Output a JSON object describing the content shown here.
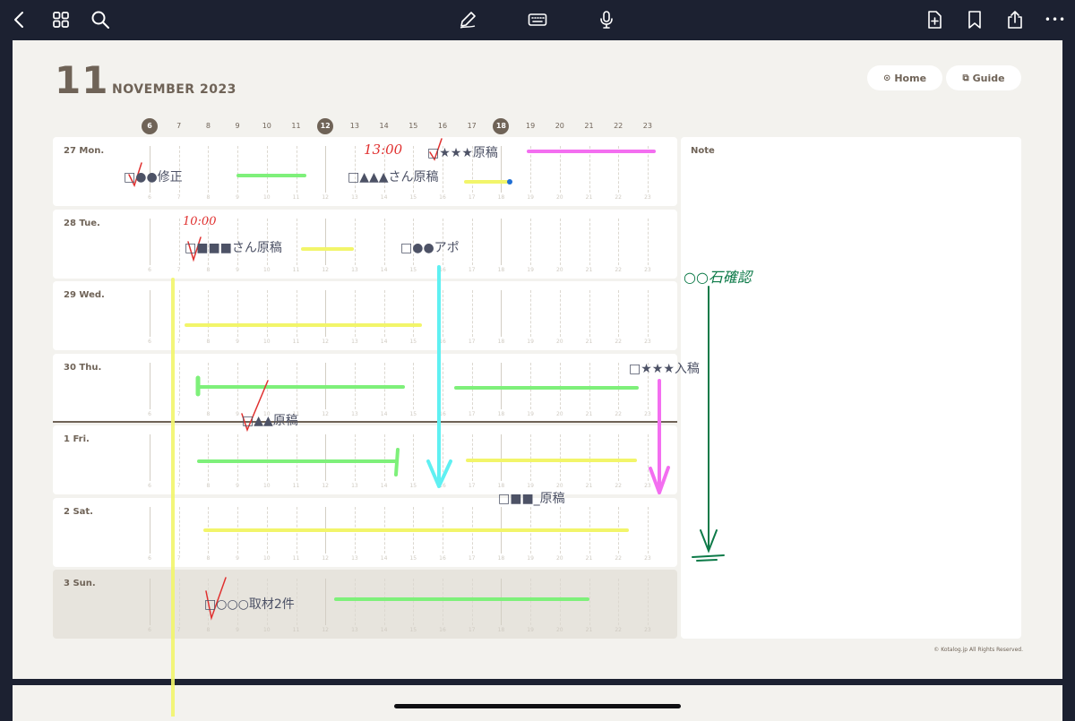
{
  "toolbar": {
    "icons": [
      "back-icon",
      "grid-icon",
      "search-icon",
      "pen-icon",
      "keyboard-icon",
      "microphone-icon",
      "add-page-icon",
      "bookmark-icon",
      "share-icon",
      "more-icon"
    ],
    "more_label": "•••"
  },
  "header": {
    "month_number": "11",
    "month_name": "NOVEMBER  2023",
    "home_label": "Home",
    "guide_label": "Guide"
  },
  "hours": [
    "6",
    "7",
    "8",
    "9",
    "10",
    "11",
    "12",
    "13",
    "14",
    "15",
    "16",
    "17",
    "18",
    "19",
    "20",
    "21",
    "22",
    "23"
  ],
  "marked_hours": [
    "6",
    "12",
    "18"
  ],
  "days": [
    {
      "label": "27  Mon.",
      "sunday": false
    },
    {
      "label": "28  Tue.",
      "sunday": false
    },
    {
      "label": "29  Wed.",
      "sunday": false
    },
    {
      "label": "30  Thu.",
      "sunday": false
    },
    {
      "label": "1    Fri.",
      "sunday": false
    },
    {
      "label": "2    Sat.",
      "sunday": false
    },
    {
      "label": "3    Sun.",
      "sunday": true
    }
  ],
  "note_panel": {
    "title": "Note"
  },
  "copyright": "© Kotalog.jp All Rights Reserved.",
  "handwriting": {
    "mon_1": "□●●修正",
    "mon_2": "□▲▲▲さん原稿",
    "mon_3": "□★★★原稿",
    "mon_time": "13:00",
    "tue_1": "□■■■さん原稿",
    "tue_2": "□●●アポ",
    "tue_time": "10:00",
    "thu_1": "□★★★入稿",
    "thu_2": "□▲▲原稿",
    "sat_1": "□■■_原稿",
    "sun_1": "□○○○取材2件",
    "note_1": "○○石確認"
  },
  "colors": {
    "topbar": "#1c2131",
    "page": "#f3f2ee",
    "accent_brown": "#6f6357",
    "marker_yellow": "#f2f56a",
    "marker_green": "#7ef07a",
    "marker_pink": "#f36ef0",
    "marker_cyan": "#5ff0f2",
    "ink_red": "#e0302f",
    "ink_green": "#0d7a48"
  }
}
